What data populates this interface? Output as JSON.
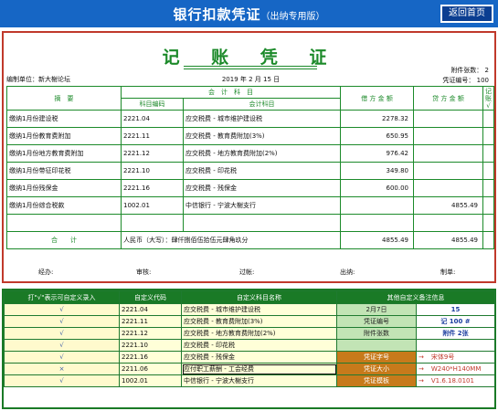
{
  "header": {
    "title": "银行扣款凭证",
    "subtitle": "（出纳专用版）",
    "return_btn": "返回首页"
  },
  "voucher": {
    "title": "记 账 凭 证",
    "unit_label": "编制单位：新大榭论坛",
    "date": "2019 年 2 月 15 日",
    "attach": "附件张数： 2",
    "voucher_no": "凭证编号： 100",
    "col_summary": "摘　要",
    "col_account": "会　计　科　目",
    "col_code": "科目编码",
    "col_subject": "会计科目",
    "col_debit": "借 方 金 额",
    "col_credit": "贷 方 金 额",
    "col_mark": "记账√",
    "rows": [
      {
        "summary": "缴纳1月份建设税",
        "code": "2221.04",
        "subject": "应交税费 - 城市维护建设税",
        "debit": "2278.32",
        "credit": ""
      },
      {
        "summary": "缴纳1月份教育费附加",
        "code": "2221.11",
        "subject": "应交税费 - 教育费附加(3%)",
        "debit": "650.95",
        "credit": ""
      },
      {
        "summary": "缴纳1月份地方教育费附加",
        "code": "2221.12",
        "subject": "应交税费 - 地方教育费附加(2%)",
        "debit": "976.42",
        "credit": ""
      },
      {
        "summary": "缴纳1月份带征印花税",
        "code": "2221.10",
        "subject": "应交税费 - 印花税",
        "debit": "349.80",
        "credit": ""
      },
      {
        "summary": "缴纳1月份残保金",
        "code": "2221.16",
        "subject": "应交税费 - 残保金",
        "debit": "600.00",
        "credit": ""
      },
      {
        "summary": "缴纳1月份综合税款",
        "code": "1002.01",
        "subject": "中信银行 - 宁波大榭支行",
        "debit": "",
        "credit": "4855.49"
      },
      {
        "summary": "",
        "code": "",
        "subject": "",
        "debit": "",
        "credit": ""
      }
    ],
    "total_label": "合　　计",
    "total_text": "人民币（大写）：肆仟捌佰伍拾伍元肆角玖分",
    "total_debit": "4855.49",
    "total_credit": "4855.49",
    "sig_manager": "经办:",
    "sig_review": "审核:",
    "sig_post": "过帐:",
    "sig_cashier": "出纳:",
    "sig_maker": "制单:"
  },
  "custom": {
    "h1": "打\"√\"表示可自定义录入",
    "h2": "自定义代码",
    "h3": "自定义科目名称",
    "h4": "其他自定义备注信息",
    "rows": [
      {
        "mark": "√",
        "code": "2221.04",
        "name": "应交税费 - 城市维护建设税",
        "k": "2月7日",
        "v": "15"
      },
      {
        "mark": "√",
        "code": "2221.11",
        "name": "应交税费 - 教育费附加(3%)",
        "k": "凭证编号",
        "v": "记 100 #"
      },
      {
        "mark": "√",
        "code": "2221.12",
        "name": "应交税费 - 地方教育费附加(2%)",
        "k": "附件张数",
        "v": "附件 2张"
      },
      {
        "mark": "√",
        "code": "2221.10",
        "name": "应交税费 - 印花税",
        "k": "",
        "v": ""
      },
      {
        "mark": "√",
        "code": "2221.16",
        "name": "应交税费 - 残保金",
        "k": "凭证字号",
        "v": "宋体9号"
      },
      {
        "mark": "×",
        "code": "2211.06",
        "name": "应付职工薪酬 - 工会经费",
        "k": "凭证大小",
        "v": "W240*H140MM"
      },
      {
        "mark": "√",
        "code": "1002.01",
        "name": "中信银行 - 宁波大榭支行",
        "k": "凭证模板",
        "v": "V1.6.18.0101"
      }
    ],
    "arrow": "→"
  },
  "colors": {
    "title_bar": "#1666c5",
    "voucher_border": "#c0392b",
    "voucher_green": "#1c8a2a",
    "lower_green": "#1a7a26",
    "remark_orange": "#c77a1b"
  }
}
